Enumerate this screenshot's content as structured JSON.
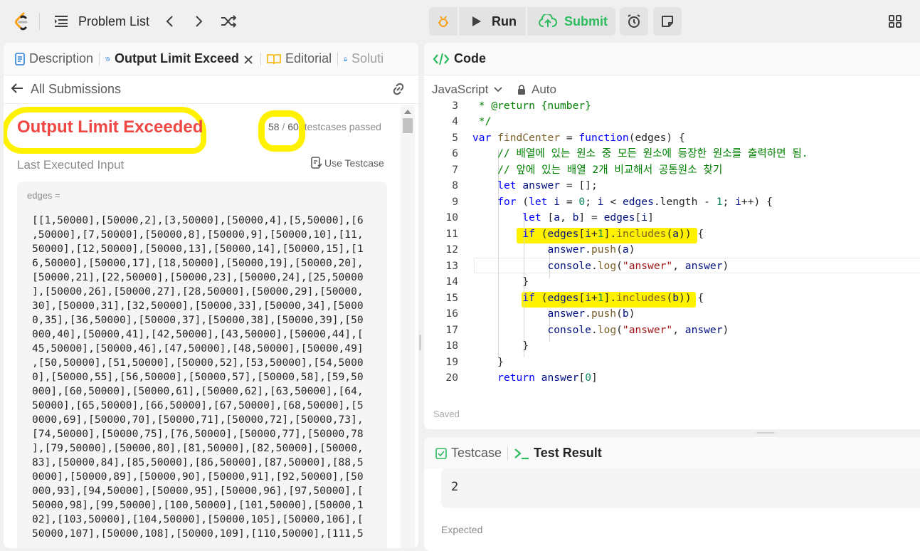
{
  "topbar": {
    "problem_list": "Problem List",
    "run": "Run",
    "submit": "Submit",
    "icons": [
      "logo",
      "list-icon",
      "chevron-left-icon",
      "chevron-right-icon",
      "shuffle-icon",
      "debug-icon",
      "play-icon",
      "upload-cloud-icon",
      "alarm-icon",
      "note-icon",
      "layout-icon"
    ]
  },
  "left": {
    "tabs": [
      "Description",
      "Output Limit Exceed",
      "Editorial",
      "Soluti"
    ],
    "all_submissions": "All Submissions",
    "status": "Output Limit Exceeded",
    "passed": "58",
    "sep": "/",
    "total": "60",
    "passed_label": "testcases passed",
    "last_input_label": "Last Executed Input",
    "use_testcase": "Use Testcase",
    "var_name": "edges =",
    "input_lines": [
      "[[1,50000],[50000,2],[3,50000],[50000,4],[5,50000],[6",
      ",50000],[7,50000],[50000,8],[50000,9],[50000,10],[11,",
      "50000],[12,50000],[50000,13],[50000,14],[50000,15],[1",
      "6,50000],[50000,17],[18,50000],[50000,19],[50000,20],",
      "[50000,21],[22,50000],[50000,23],[50000,24],[25,50000",
      "],[50000,26],[50000,27],[28,50000],[50000,29],[50000,",
      "30],[50000,31],[32,50000],[50000,33],[50000,34],[5000",
      "0,35],[36,50000],[50000,37],[50000,38],[50000,39],[50",
      "000,40],[50000,41],[42,50000],[43,50000],[50000,44],[",
      "45,50000],[50000,46],[47,50000],[48,50000],[50000,49]",
      ",[50,50000],[51,50000],[50000,52],[53,50000],[54,5000",
      "0],[50000,55],[56,50000],[50000,57],[50000,58],[59,50",
      "000],[60,50000],[50000,61],[50000,62],[63,50000],[64,",
      "50000],[65,50000],[66,50000],[67,50000],[68,50000],[5",
      "0000,69],[50000,70],[50000,71],[50000,72],[50000,73],",
      "[74,50000],[50000,75],[76,50000],[50000,77],[50000,78",
      "],[79,50000],[50000,80],[81,50000],[82,50000],[50000,",
      "83],[50000,84],[85,50000],[86,50000],[87,50000],[88,5",
      "0000],[50000,89],[50000,90],[50000,91],[92,50000],[50",
      "000,93],[94,50000],[50000,95],[50000,96],[97,50000],[",
      "50000,98],[99,50000],[100,50000],[101,50000],[50000,1",
      "02],[103,50000],[104,50000],[50000,105],[50000,106],[",
      "50000,107],[50000,108],[50000,109],[110,50000],[111,5"
    ]
  },
  "code": {
    "title": "Code",
    "language": "JavaScript",
    "auto": "Auto",
    "saved": "Saved",
    "line_numbers": [
      "3",
      "4",
      "5",
      "6",
      "7",
      "8",
      "9",
      "10",
      "11",
      "12",
      "13",
      "14",
      "15",
      "16",
      "17",
      "18",
      "19",
      "20"
    ]
  },
  "bottom": {
    "testcase_tab": "Testcase",
    "result_tab": "Test Result",
    "output": "2",
    "expected_label": "Expected"
  }
}
